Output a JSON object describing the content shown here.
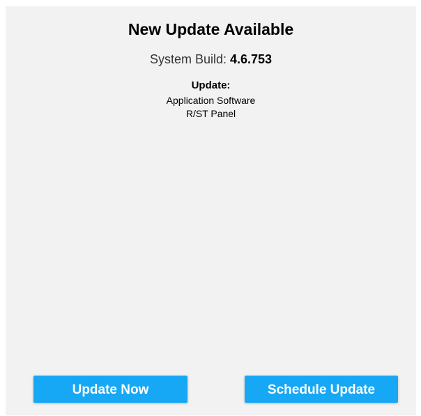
{
  "dialog": {
    "title": "New Update Available",
    "build_label": "System Build: ",
    "build_value": "4.6.753",
    "update_heading": "Update:",
    "update_items": [
      "Application Software",
      "R/ST Panel"
    ]
  },
  "actions": {
    "update_now_label": "Update Now",
    "schedule_label": "Schedule Update"
  },
  "colors": {
    "panel_background": "#f2f2f2",
    "button_background": "#17a8f5",
    "button_text": "#ffffff"
  }
}
